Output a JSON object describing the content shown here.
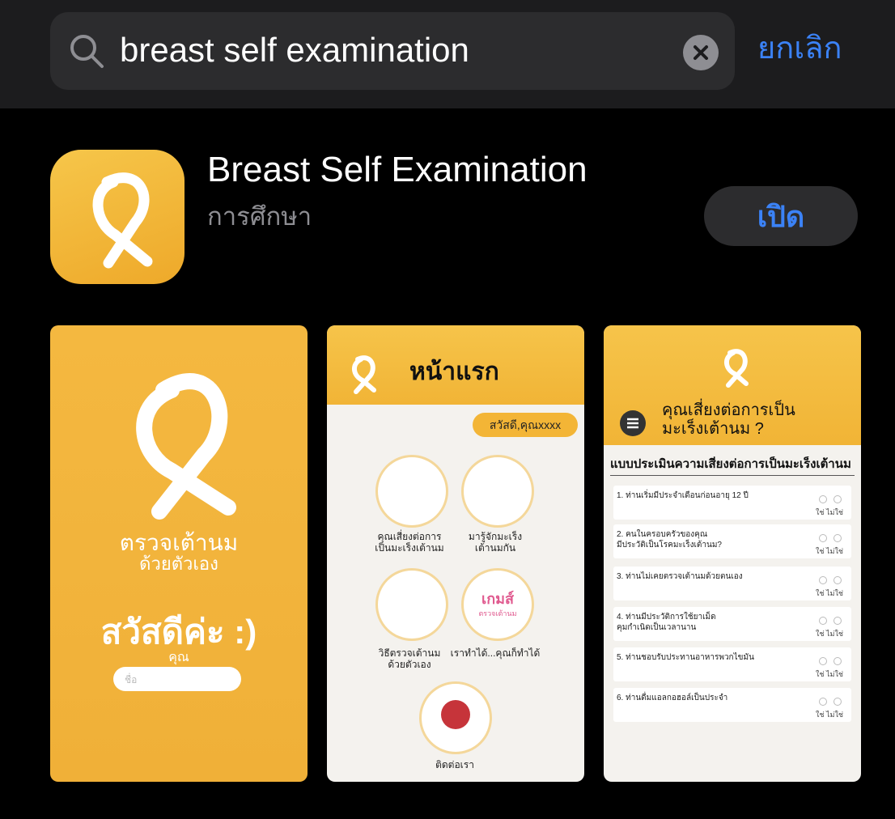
{
  "search": {
    "query": "breast self examination",
    "cancel_label": "ยกเลิก"
  },
  "app": {
    "name": "Breast Self Examination",
    "category": "การศึกษา",
    "open_label": "เปิด"
  },
  "screenshots": {
    "s1": {
      "title": "ตรวจเต้านม",
      "subtitle": "ด้วยตัวเอง",
      "greeting": "สวัสดีค่ะ :)",
      "you_label": "คุณ",
      "name_placeholder": "ชื่อ"
    },
    "s2": {
      "title": "หน้าแรก",
      "greeting": "สวัสดี,คุณxxxx",
      "items": [
        {
          "label": "คุณเสี่ยงต่อการ\nเป็นมะเร็งเต้านม"
        },
        {
          "label": "มารู้จักมะเร็ง\nเต้านมกัน"
        },
        {
          "label": "วิธีตรวจเต้านม\nด้วยตัวเอง"
        },
        {
          "label": "เราทำได้...คุณก็ทำได้"
        },
        {
          "label": "ติดต่อเรา"
        }
      ],
      "game_label": "เกมส์",
      "game_sub": "ตรวจเต้านม"
    },
    "s3": {
      "title": "คุณเสี่ยงต่อการเป็น\nมะเร็งเต้านม ?",
      "section": "แบบประเมินความเสี่ยงต่อการเป็นมะเร็งเต้านม",
      "yes": "ใช่",
      "no": "ไม่ใช่",
      "questions": [
        "1. ท่านเริ่มมีประจำเดือนก่อนอายุ 12 ปี",
        "2. คนในครอบครัวของคุณ\nมีประวัติเป็นโรคมะเร็งเต้านม?",
        "3. ท่านไม่เคยตรวจเต้านมด้วยตนเอง",
        "4. ท่านมีประวัติการใช้ยาเม็ด\nคุมกำเนิดเป็นเวลานาน",
        "5. ท่านชอบรับประทานอาหารพวกไขมัน",
        "6. ท่านดื่มแอลกอฮอล์เป็นประจำ"
      ]
    }
  },
  "colors": {
    "accent": "#3b82f6",
    "brand_yellow": "#f2b53a"
  }
}
